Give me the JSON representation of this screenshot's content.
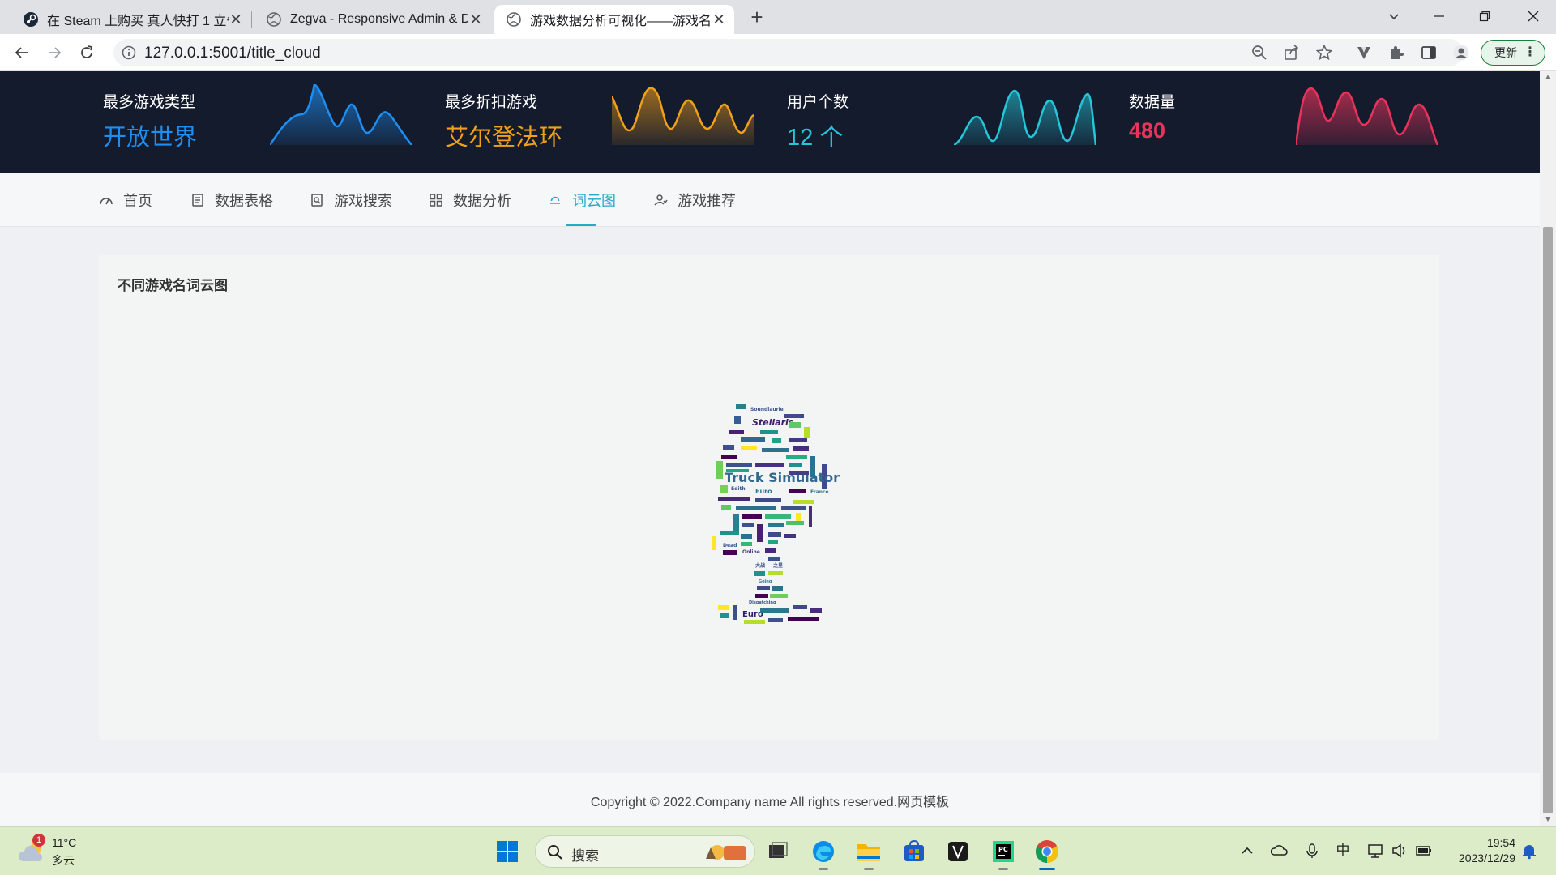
{
  "browser": {
    "tabs": [
      {
        "title": "在 Steam 上购买 真人快打 1 立省",
        "icon": "steam-icon",
        "active": false
      },
      {
        "title": "Zegva - Responsive Admin & D",
        "icon": "globe-icon",
        "active": false
      },
      {
        "title": "游戏数据分析可视化——游戏名",
        "icon": "globe-icon",
        "active": true
      }
    ],
    "new_tab_label": "+",
    "url_host": "127.0.0.1",
    "url_path": ":5001/title_cloud",
    "update_label": "更新",
    "close_glyph": "✕"
  },
  "stats": [
    {
      "label": "最多游戏类型",
      "value": "开放世界",
      "color": "#1f8ef1"
    },
    {
      "label": "最多折扣游戏",
      "value": "艾尔登法环",
      "color": "#f2a01a"
    },
    {
      "label": "用户个数",
      "value": "12 个",
      "color": "#26c6da"
    },
    {
      "label": "数据量",
      "value": "480",
      "color": "#e8335b"
    }
  ],
  "nav": {
    "items": [
      {
        "label": "首页",
        "icon": "dashboard-icon"
      },
      {
        "label": "数据表格",
        "icon": "document-icon"
      },
      {
        "label": "游戏搜索",
        "icon": "search-doc-icon"
      },
      {
        "label": "数据分析",
        "icon": "grid-icon"
      },
      {
        "label": "词云图",
        "icon": "cloud-icon"
      },
      {
        "label": "游戏推荐",
        "icon": "user-recommend-icon"
      }
    ],
    "active_index": 4
  },
  "card": {
    "title": "不同游戏名词云图",
    "word_cloud": {
      "words": [
        "Truck Simulator",
        "Stellaris",
        "Euro",
        "Simulator",
        "Soundlaurie",
        "Manager",
        "France",
        "Legends",
        "Edith",
        "Dead",
        "Online",
        "Going",
        "Dispatching",
        "GRID",
        "Windows",
        "大战",
        "之星",
        "模拟",
        "真人",
        "极品飞车",
        "世界",
        "传说"
      ]
    }
  },
  "footer": {
    "copyright": "Copyright © 2022.Company name All rights reserved.",
    "link": "网页模板"
  },
  "taskbar": {
    "weather_temp": "11°C",
    "weather_cond": "多云",
    "weather_badge": "1",
    "search_placeholder": "搜索",
    "ime": "中",
    "time": "19:54",
    "date": "2023/12/29"
  }
}
